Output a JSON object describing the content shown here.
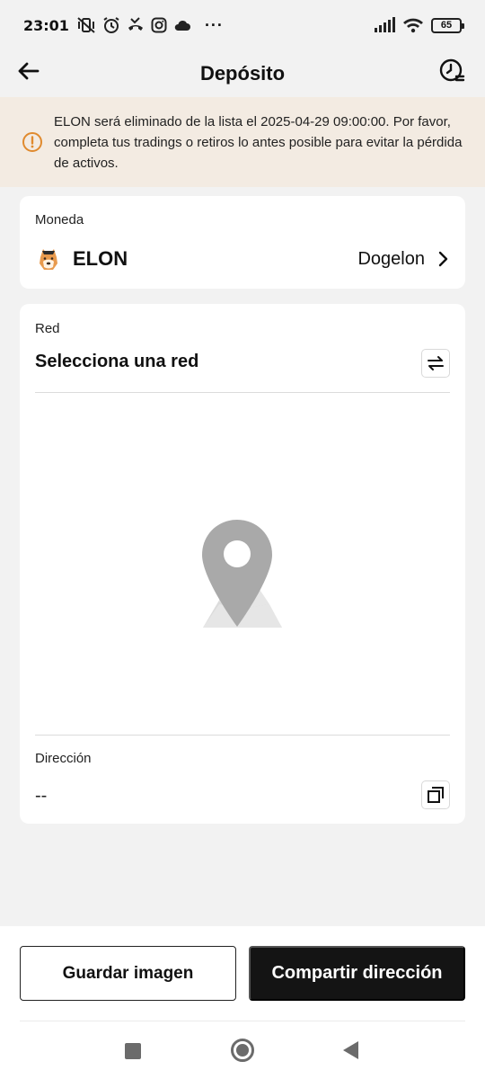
{
  "status_bar": {
    "time": "23:01",
    "left_icons": [
      "mute-vibrate-icon",
      "alarm-icon",
      "missed-call-icon",
      "instagram-icon",
      "cloud-icon",
      "more-dots-icon"
    ],
    "more": "···",
    "battery": "65"
  },
  "header": {
    "title": "Depósito"
  },
  "notice": {
    "text": "ELON será eliminado de la lista el 2025-04-29 09:00:00. Por favor, completa tus tradings o retiros lo antes posible para evitar la pérdida de activos.",
    "color": "#e08a2e"
  },
  "coin": {
    "label": "Moneda",
    "symbol": "ELON",
    "name": "Dogelon"
  },
  "network": {
    "label": "Red",
    "placeholder": "Selecciona una red"
  },
  "address": {
    "label": "Dirección",
    "value": "--"
  },
  "footer": {
    "save_label": "Guardar imagen",
    "share_label": "Compartir dirección"
  }
}
